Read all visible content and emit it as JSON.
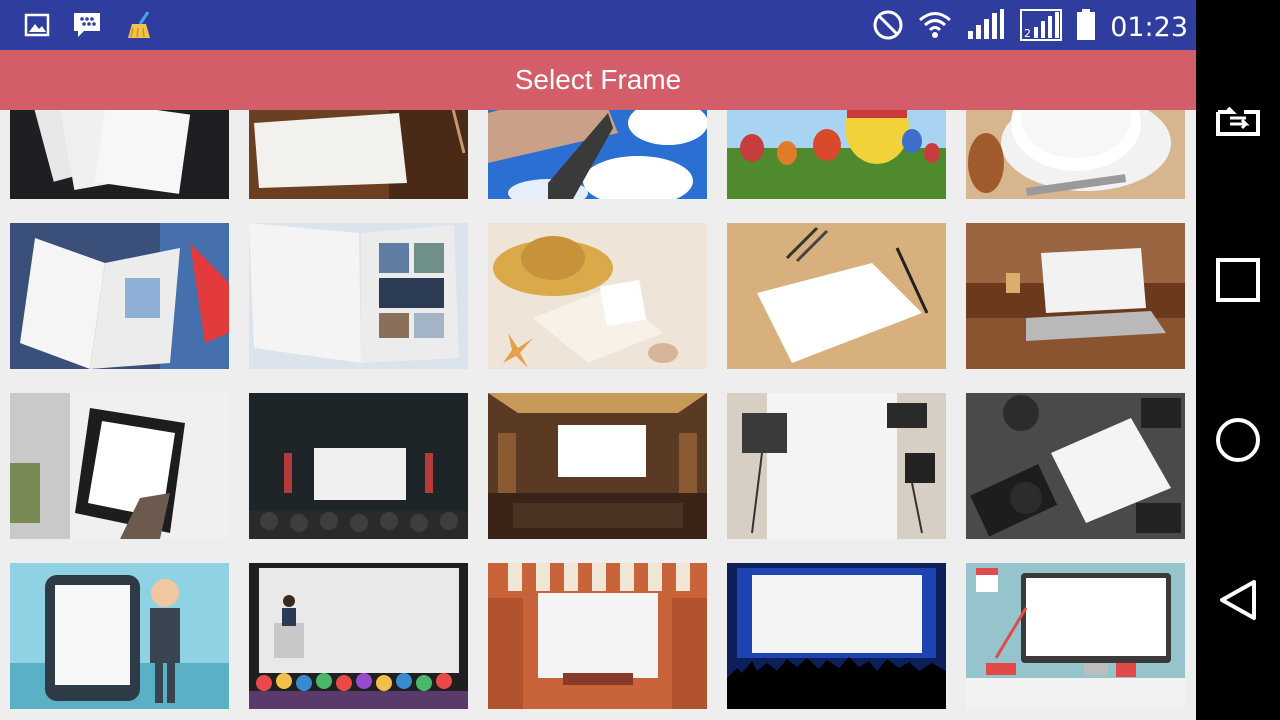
{
  "status_bar": {
    "time": "01:23",
    "left_icons": [
      "image-icon",
      "blackberry-messenger-icon",
      "cleaner-broom-icon"
    ],
    "right_icons": [
      "do-not-disturb-icon",
      "wifi-icon",
      "signal-sim1-icon",
      "signal-sim2-icon",
      "battery-icon"
    ]
  },
  "app_bar": {
    "title": "Select Frame"
  },
  "frames": [
    {
      "id": "frame-papers"
    },
    {
      "id": "frame-torn-paper"
    },
    {
      "id": "frame-sky-hand"
    },
    {
      "id": "frame-balloons"
    },
    {
      "id": "frame-coffee"
    },
    {
      "id": "frame-open-book"
    },
    {
      "id": "frame-magazine"
    },
    {
      "id": "frame-beach-notebook"
    },
    {
      "id": "frame-desk-paper"
    },
    {
      "id": "frame-laptop"
    },
    {
      "id": "frame-tablet-hand"
    },
    {
      "id": "frame-cinema"
    },
    {
      "id": "frame-home-theater"
    },
    {
      "id": "frame-photo-studio"
    },
    {
      "id": "frame-camera-desk"
    },
    {
      "id": "frame-cartoon-tablet"
    },
    {
      "id": "frame-presentation"
    },
    {
      "id": "frame-theater-stage"
    },
    {
      "id": "frame-concert"
    },
    {
      "id": "frame-desktop-monitor"
    }
  ],
  "colors": {
    "status_bar": "#2f3e9e",
    "app_bar": "#d35e6a",
    "background": "#eeeeee",
    "nav_bar": "#000000"
  },
  "nav_bar": {
    "icons": [
      "rotate-screen-icon",
      "recent-apps-icon",
      "home-icon",
      "back-icon"
    ]
  }
}
